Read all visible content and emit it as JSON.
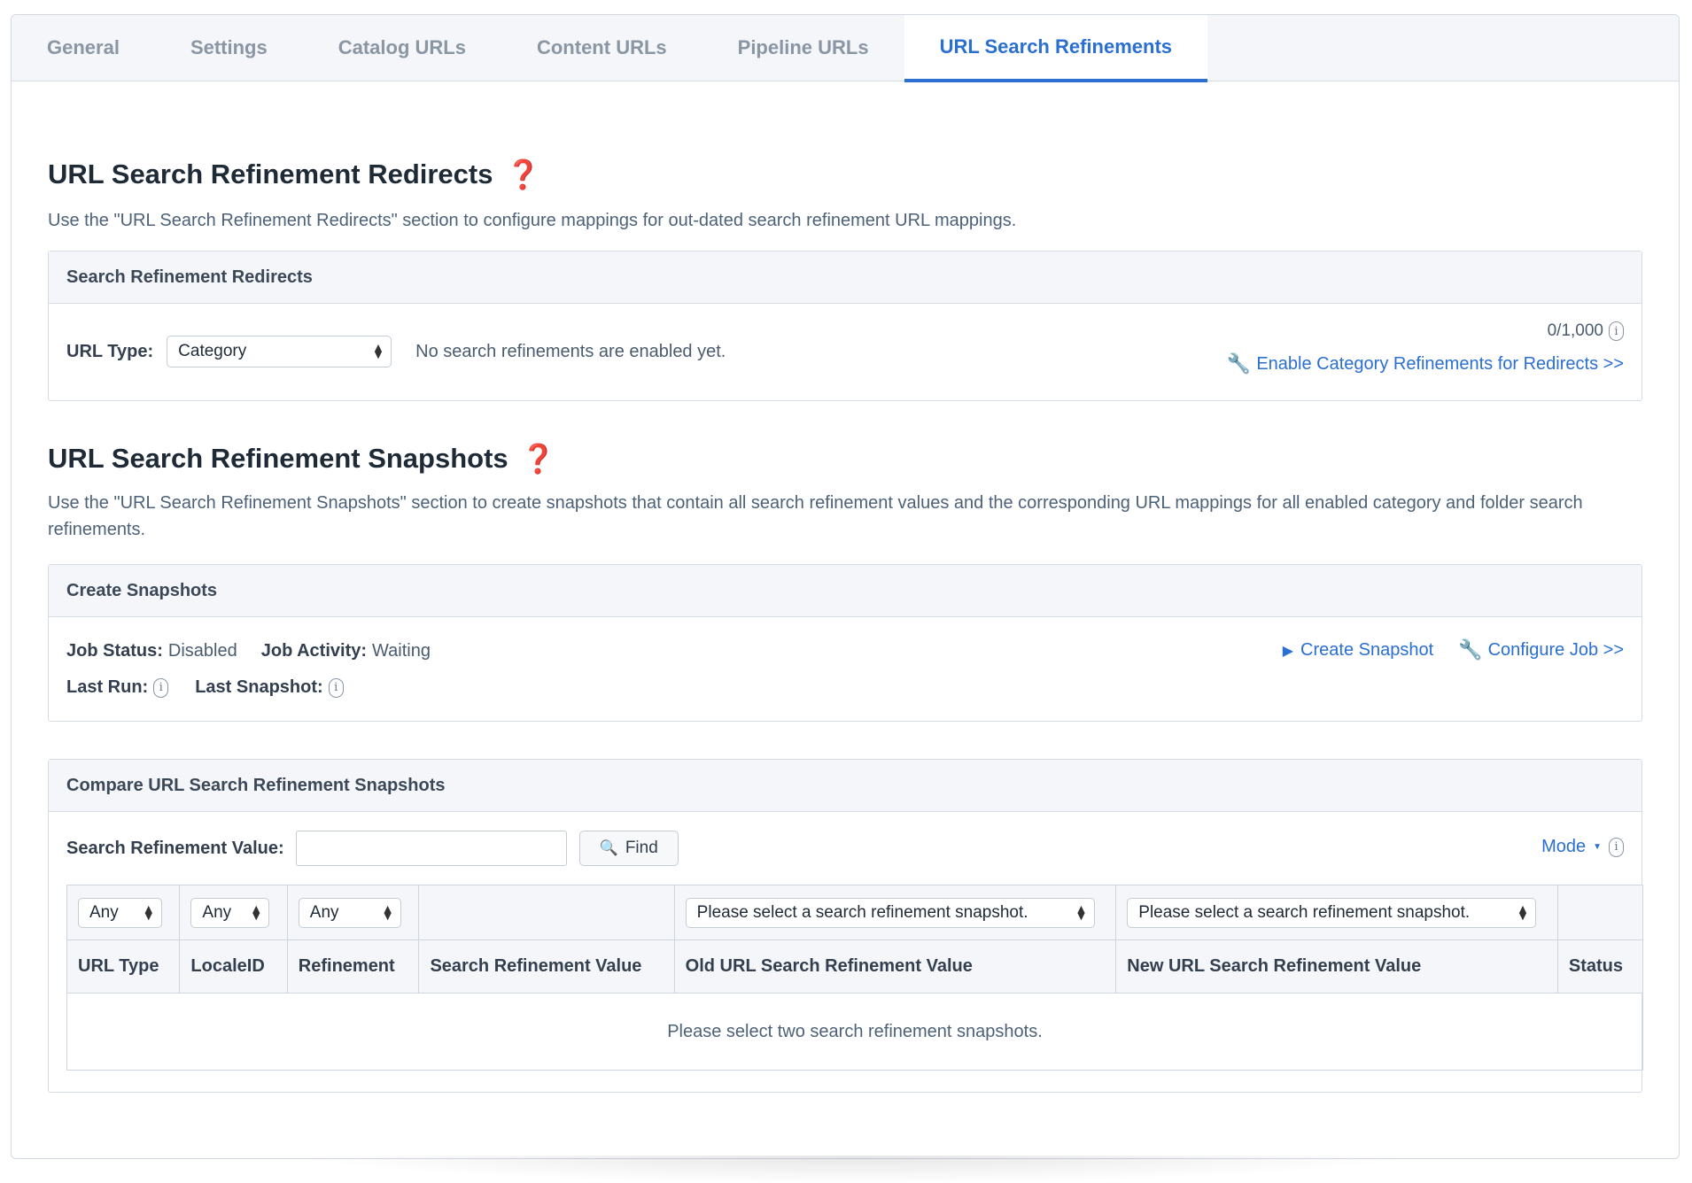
{
  "tabs": [
    {
      "label": "General"
    },
    {
      "label": "Settings"
    },
    {
      "label": "Catalog URLs"
    },
    {
      "label": "Content URLs"
    },
    {
      "label": "Pipeline URLs"
    },
    {
      "label": "URL Search Refinements",
      "active": true
    }
  ],
  "redirects": {
    "title": "URL Search Refinement Redirects",
    "description": "Use the \"URL Search Refinement Redirects\" section to configure mappings for out-dated search refinement URL mappings.",
    "panel_title": "Search Refinement Redirects",
    "url_type_label": "URL Type:",
    "url_type_value": "Category",
    "empty_message": "No search refinements are enabled yet.",
    "count": "0/1,000",
    "enable_link": "Enable Category Refinements for Redirects >>"
  },
  "snapshots": {
    "title": "URL Search Refinement Snapshots",
    "description": "Use the \"URL Search Refinement Snapshots\" section to create snapshots that contain all search refinement values and the corresponding URL mappings for all enabled category and folder search refinements.",
    "panel_title": "Create Snapshots",
    "job_status_label": "Job Status:",
    "job_status_value": "Disabled",
    "job_activity_label": "Job Activity:",
    "job_activity_value": "Waiting",
    "last_run_label": "Last Run:",
    "last_snapshot_label": "Last Snapshot:",
    "create_link": "Create Snapshot",
    "configure_link": "Configure Job >>"
  },
  "compare": {
    "panel_title": "Compare URL Search Refinement Snapshots",
    "search_label": "Search Refinement Value:",
    "search_value": "",
    "find_button": "Find",
    "mode_link": "Mode",
    "filters": {
      "url_type": "Any",
      "locale": "Any",
      "refinement": "Any",
      "old_snapshot": "Please select a search refinement snapshot.",
      "new_snapshot": "Please select a search refinement snapshot."
    },
    "columns": [
      "URL Type",
      "LocaleID",
      "Refinement",
      "Search Refinement Value",
      "Old URL Search Refinement Value",
      "New URL Search Refinement Value",
      "Status"
    ],
    "empty_message": "Please select two search refinement snapshots."
  },
  "icons": {
    "help": "question-mark-icon",
    "info": "info-icon",
    "wrench": "wrench-icon",
    "play": "play-icon",
    "search": "magnifier-icon"
  },
  "colors": {
    "accent": "#2a6fd1",
    "help_red": "#c9252c",
    "header_bg": "#f4f6f9"
  }
}
